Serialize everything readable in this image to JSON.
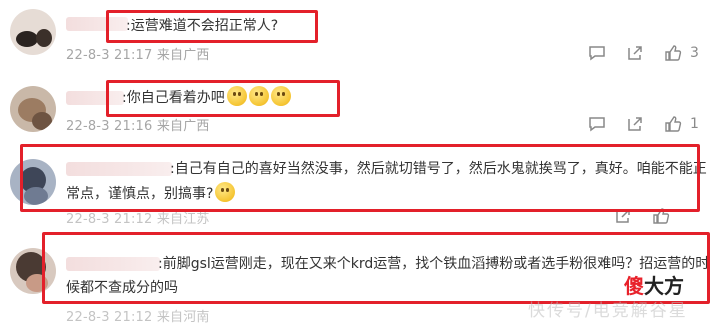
{
  "comments": [
    {
      "text": ":运营难道不会招正常人?",
      "date": "22-8-3 21:17",
      "source": "来自广西",
      "likes": "3"
    },
    {
      "text": ":你自己看着办吧",
      "date": "22-8-3 21:16",
      "source": "来自广西",
      "likes": "1"
    },
    {
      "text_line1": ":自己有自己的喜好当然没事，然后就切错号了，然后水鬼就挨骂了，真好。咱能不能正",
      "text_line2": "常点，谨慎点，别搞事?",
      "date": "22-8-3 21:12",
      "source": "来自江苏",
      "likes": ""
    },
    {
      "text_line1": ":前脚gsl运营刚走，现在又来个krd运营，找个铁血滔搏粉或者选手粉很难吗？招运营的时",
      "text_line2": "候都不查成分的吗",
      "date": "22-8-3 21:12",
      "source": "来自河南",
      "likes": ""
    }
  ],
  "icons": [
    "chat-icon",
    "share-icon",
    "thumbs-up-icon"
  ],
  "logo": {
    "part1": "傻",
    "part2": "大方"
  },
  "watermark": "快传号/电竞解谷星",
  "colors": {
    "highlight": "#e3202a",
    "meta": "#a6a6a6"
  }
}
